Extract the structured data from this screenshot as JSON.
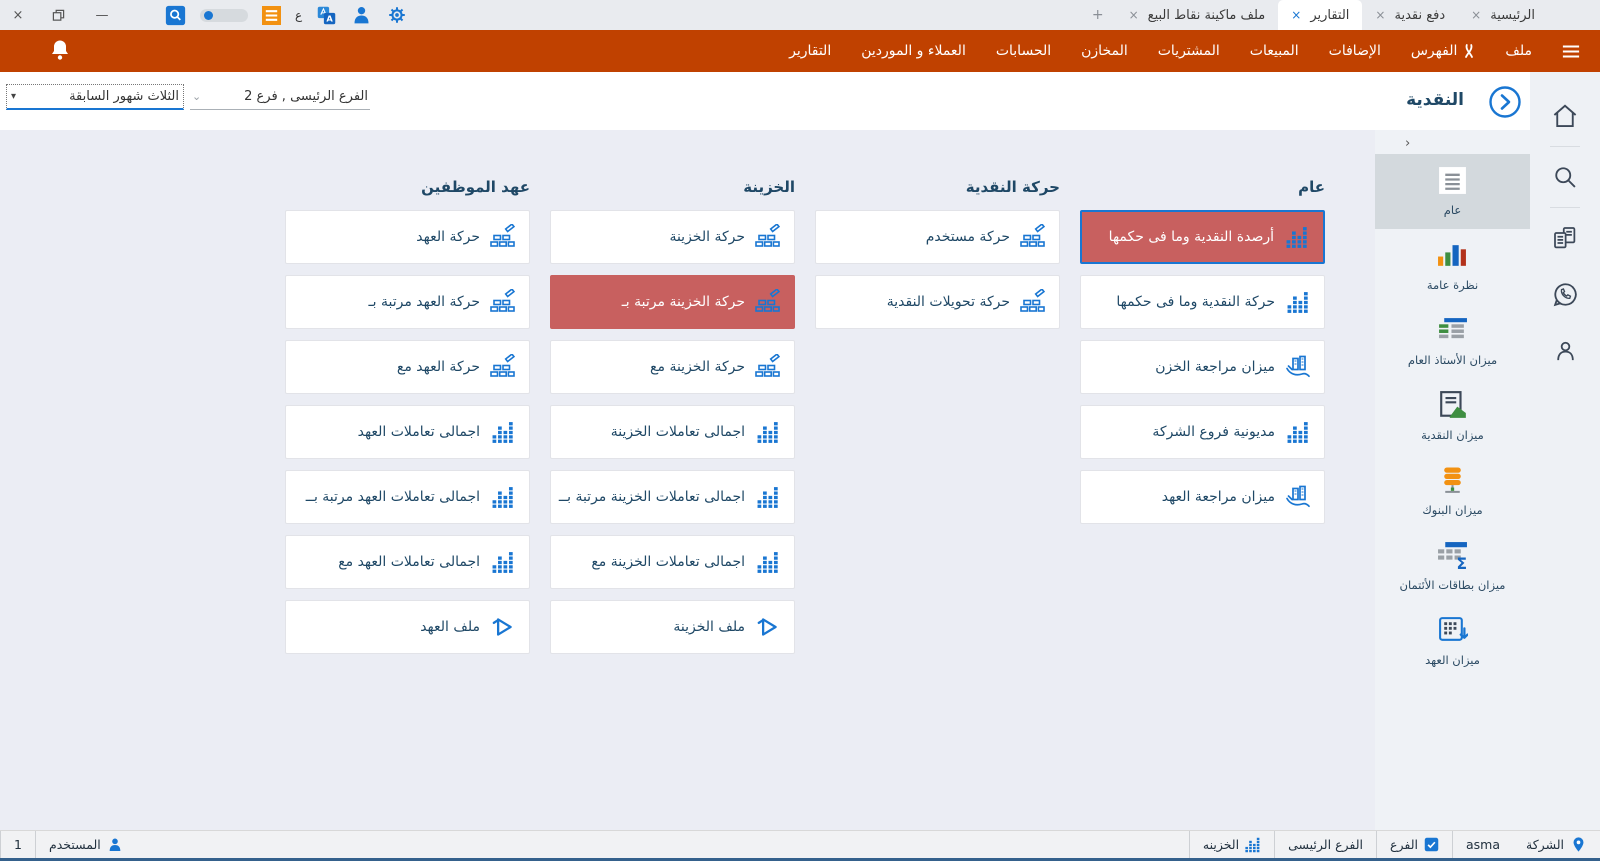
{
  "titlebar": {
    "tabs": [
      {
        "label": "الرئيسية",
        "active": false
      },
      {
        "label": "دفع نقدية",
        "active": false
      },
      {
        "label": "التقارير",
        "active": true
      },
      {
        "label": "ملف ماكينة نقاط البيع",
        "active": false
      }
    ],
    "new_tab_label": "+",
    "close_glyph": "×",
    "minimize_glyph": "—",
    "arabic_letter": "ع",
    "icons": [
      "search-box-icon",
      "toggle-switch",
      "list-icon",
      "language-letter",
      "translate-icon",
      "user-icon",
      "settings-gear-icon"
    ]
  },
  "menubar": {
    "items": [
      {
        "label": "ملف"
      },
      {
        "label": "الفهرس",
        "icon": "ribbon"
      },
      {
        "label": "الإضافات"
      },
      {
        "label": "المبيعات"
      },
      {
        "label": "المشتريات"
      },
      {
        "label": "المخازن"
      },
      {
        "label": "الحسابات"
      },
      {
        "label": "العملاء و الموردين"
      },
      {
        "label": "التقارير"
      }
    ]
  },
  "header": {
    "title": "النقدية",
    "branch_filter": "الفرع الرئيسى , فرع 2",
    "branch_chevron": "⌄",
    "period_filter": "الثلاث شهور السابقة",
    "period_chevron": "▾"
  },
  "rail_icons": [
    "home-icon",
    "search-icon",
    "copy-documents-icon",
    "whatsapp-icon",
    "profile-icon"
  ],
  "sidebar": {
    "collapse_arrow": "›",
    "items": [
      {
        "label": "عام",
        "icon": "doc-general",
        "selected": true
      },
      {
        "label": "نظرة عامة",
        "icon": "overview-chart",
        "selected": false
      },
      {
        "label": "ميزان الأستاذ العام",
        "icon": "ledger-table",
        "selected": false
      },
      {
        "label": "ميزان النقدية",
        "icon": "cash-report",
        "selected": false
      },
      {
        "label": "ميزان البنوك",
        "icon": "database",
        "selected": false
      },
      {
        "label": "ميزان بطاقات الأئتمان",
        "icon": "sum-table",
        "selected": false
      },
      {
        "label": "ميزان العهد",
        "icon": "grid-arrow",
        "selected": false
      }
    ]
  },
  "columns": [
    {
      "header": "عام",
      "cards": [
        {
          "label": "أرصدة النقدية وما فى حكمها",
          "icon": "bars",
          "state": "selected"
        },
        {
          "label": "حركة النقدية وما فى حكمها",
          "icon": "bars",
          "state": "normal"
        },
        {
          "label": "ميزان مراجعة الخزن",
          "icon": "review",
          "state": "normal"
        },
        {
          "label": "مديونية فروع الشركة",
          "icon": "bars",
          "state": "normal"
        },
        {
          "label": "ميزان مراجعة العهد",
          "icon": "review",
          "state": "normal"
        }
      ]
    },
    {
      "header": "حركة النقدية",
      "cards": [
        {
          "label": "حركة مستخدم",
          "icon": "bricks",
          "state": "normal"
        },
        {
          "label": "حركة تحويلات النقدية",
          "icon": "bricks",
          "state": "normal"
        }
      ]
    },
    {
      "header": "الخزينة",
      "cards": [
        {
          "label": "حركة الخزينة",
          "icon": "bricks",
          "state": "normal"
        },
        {
          "label": "حركة الخزينة مرتبة بـ",
          "icon": "bricks",
          "state": "highlighted"
        },
        {
          "label": "حركة الخزينة مع",
          "icon": "bricks",
          "state": "normal"
        },
        {
          "label": "اجمالى تعاملات الخزينة",
          "icon": "bars",
          "state": "normal"
        },
        {
          "label": "اجمالى تعاملات الخزينة مرتبة بــ",
          "icon": "bars",
          "state": "normal"
        },
        {
          "label": "اجمالى تعاملات الخزينة مع",
          "icon": "bars",
          "state": "normal"
        },
        {
          "label": "ملف الخزينة",
          "icon": "play",
          "state": "normal"
        }
      ]
    },
    {
      "header": "عهد الموظفين",
      "cards": [
        {
          "label": "حركة العهد",
          "icon": "bricks",
          "state": "normal"
        },
        {
          "label": "حركة العهد مرتبة بـ",
          "icon": "bricks",
          "state": "normal"
        },
        {
          "label": "حركة العهد مع",
          "icon": "bricks",
          "state": "normal"
        },
        {
          "label": "اجمالى تعاملات العهد",
          "icon": "bars",
          "state": "normal"
        },
        {
          "label": "اجمالى تعاملات العهد مرتبة بــ",
          "icon": "bars",
          "state": "normal"
        },
        {
          "label": "اجمالى تعاملات العهد مع",
          "icon": "bars",
          "state": "normal"
        },
        {
          "label": "ملف العهد",
          "icon": "play",
          "state": "normal"
        }
      ]
    }
  ],
  "statusbar": {
    "right": [
      {
        "label": "الشركة",
        "icon": "pin"
      },
      {
        "label": "asma"
      },
      {
        "label": "الفرع",
        "icon": "checkbox"
      },
      {
        "label": "الفرع الرئيسى"
      },
      {
        "label": "الخزينه",
        "icon": "bars-small"
      }
    ],
    "left": [
      {
        "label": "المستخدم",
        "icon": "person"
      },
      {
        "label": "1"
      }
    ]
  },
  "colors": {
    "accent_blue": "#1976d2",
    "menubar_orange": "#c04100",
    "selected_red": "#c8605f",
    "navy_text": "#1f4866",
    "content_bg": "#ebedf4",
    "status_line_blue": "#35618c"
  }
}
